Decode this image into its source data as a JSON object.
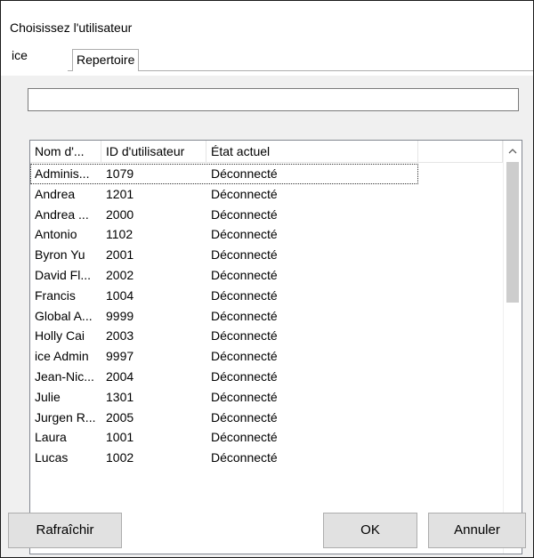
{
  "window": {
    "title": "Choisissez l'utilisateur"
  },
  "tabs": [
    {
      "label": "ice",
      "active": true
    },
    {
      "label": "Repertoire",
      "active": false
    }
  ],
  "search": {
    "value": "",
    "placeholder": ""
  },
  "table": {
    "columns": [
      "Nom d'...",
      "ID d'utilisateur",
      "État actuel",
      ""
    ],
    "rows": [
      {
        "name": "Adminis...",
        "id": "1079",
        "status": "Déconnecté"
      },
      {
        "name": "Andrea",
        "id": "1201",
        "status": "Déconnecté"
      },
      {
        "name": "Andrea ...",
        "id": "2000",
        "status": "Déconnecté"
      },
      {
        "name": "Antonio",
        "id": "1102",
        "status": "Déconnecté"
      },
      {
        "name": "Byron Yu",
        "id": "2001",
        "status": "Déconnecté"
      },
      {
        "name": "David Fl...",
        "id": "2002",
        "status": "Déconnecté"
      },
      {
        "name": "Francis",
        "id": "1004",
        "status": "Déconnecté"
      },
      {
        "name": "Global A...",
        "id": "9999",
        "status": "Déconnecté"
      },
      {
        "name": "Holly Cai",
        "id": "2003",
        "status": "Déconnecté"
      },
      {
        "name": "ice Admin",
        "id": "9997",
        "status": "Déconnecté"
      },
      {
        "name": "Jean-Nic...",
        "id": "2004",
        "status": "Déconnecté"
      },
      {
        "name": "Julie",
        "id": "1301",
        "status": "Déconnecté"
      },
      {
        "name": "Jurgen R...",
        "id": "2005",
        "status": "Déconnecté"
      },
      {
        "name": "Laura",
        "id": "1001",
        "status": "Déconnecté"
      },
      {
        "name": "Lucas",
        "id": "1002",
        "status": "Déconnecté"
      }
    ]
  },
  "scrollbar": {
    "up_icon": "chevron-up-icon",
    "down_icon": "chevron-down-icon"
  },
  "buttons": {
    "refresh": "Rafraîchir",
    "ok": "OK",
    "cancel": "Annuler"
  }
}
